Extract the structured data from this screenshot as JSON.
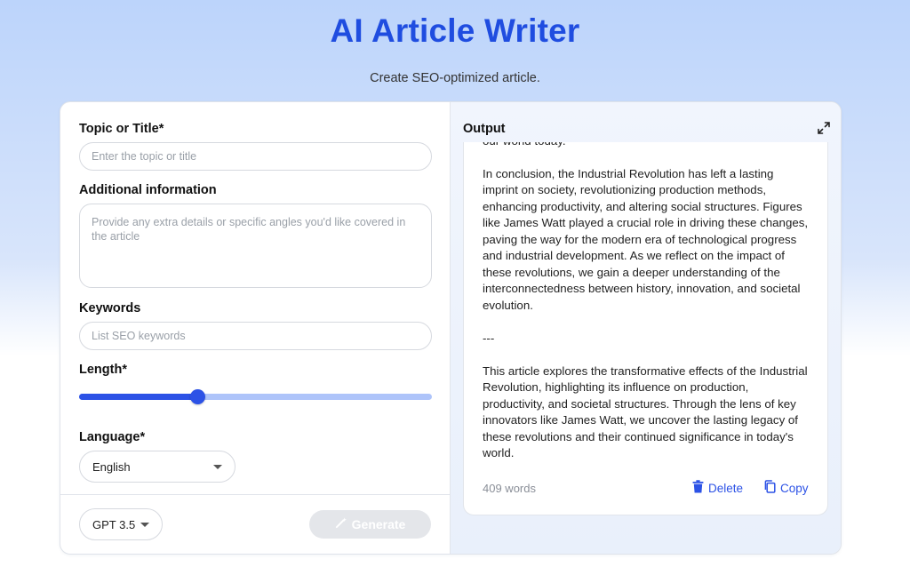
{
  "header": {
    "title": "AI Article Writer",
    "subtitle": "Create SEO-optimized article."
  },
  "form": {
    "topic": {
      "label": "Topic or Title*",
      "placeholder": "Enter the topic or title",
      "value": ""
    },
    "additional": {
      "label": "Additional information",
      "placeholder": "Provide any extra details or specific angles you'd like covered in the article",
      "value": ""
    },
    "keywords": {
      "label": "Keywords",
      "placeholder": "List SEO keywords",
      "value": ""
    },
    "length": {
      "label": "Length*",
      "value_fraction": 0.335
    },
    "language": {
      "label": "Language*",
      "selected": "English"
    },
    "model": {
      "selected": "GPT 3.5"
    },
    "generate_label": "Generate"
  },
  "output": {
    "title": "Output",
    "paragraphs": [
      "our world today.",
      "In conclusion, the Industrial Revolution has left a lasting imprint on society, revolutionizing production methods, enhancing productivity, and altering social structures. Figures like James Watt played a crucial role in driving these changes, paving the way for the modern era of technological progress and industrial development. As we reflect on the impact of these revolutions, we gain a deeper understanding of the interconnectedness between history, innovation, and societal evolution.",
      "---",
      "This article explores the transformative effects of the Industrial Revolution, highlighting its influence on production, productivity, and societal structures. Through the lens of key innovators like James Watt, we uncover the lasting legacy of these revolutions and their continued significance in today's world."
    ],
    "word_count": "409 words",
    "delete_label": "Delete",
    "copy_label": "Copy"
  },
  "colors": {
    "accent": "#2c52e6",
    "title": "#1f4de0",
    "slider_track": "#aec4fa",
    "generate_disabled": "#e4e6ea"
  },
  "icons": {
    "expand": "expand-icon",
    "wand": "magic-wand-icon",
    "trash": "trash-icon",
    "copy": "copy-icon",
    "caret": "chevron-down-icon"
  }
}
